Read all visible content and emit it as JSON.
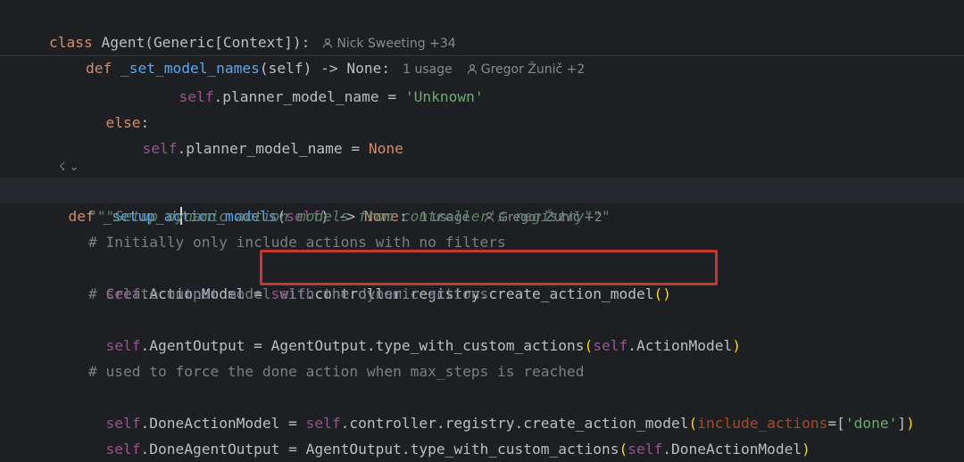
{
  "sticky": {
    "class_def": {
      "keyword": "class",
      "name": " Agent(Generic[Context]):",
      "author": "Nick Sweeting +34"
    },
    "method_def": {
      "keyword": "def",
      "name": "_set_model_names",
      "params": "(self) -> None:",
      "usage": "1 usage",
      "author": "Gregor Žunič +2"
    }
  },
  "code": {
    "line1": {
      "self": "self",
      "rest": ".planner_model_name = ",
      "value": "'Unknown'"
    },
    "line2": {
      "keyword": "else",
      "rest": ":"
    },
    "line3": {
      "self": "self",
      "rest": ".planner_model_name = ",
      "value": "None"
    },
    "gutter_icon": "☇",
    "method": {
      "keyword": "def",
      "name_before_caret": "_setup_ac",
      "name_after_caret": "tion_models",
      "paren_open": "(",
      "self": "self",
      "paren_close": ")",
      "returns": " -> ",
      "none": "None",
      "colon": ":",
      "usage": "1 usage",
      "author": "Gregor Žunič +2"
    },
    "docstring": "\"\"\"Setup dynamic action models from controller's registry\"\"\"",
    "comment1": "# Initially only include actions with no filters",
    "line_action_model": {
      "self": "self",
      "lhs": ".ActionModel = ",
      "self2": "self",
      "rhs": ".controller.registry.create_action_model",
      "parens": "()"
    },
    "comment2": "# Create output model with the dynamic actions",
    "line_agent_output": {
      "self": "self",
      "lhs": ".AgentOutput = AgentOutput.type_with_custom_actions",
      "paren_open": "(",
      "self2": "self",
      "arg": ".ActionModel",
      "paren_close": ")"
    },
    "comment3": "# used to force the done action when max_steps is reached",
    "line_done_action": {
      "self": "self",
      "lhs": ".DoneActionModel = ",
      "self2": "self",
      "rhs": ".controller.registry.create_action_model",
      "paren_open": "(",
      "kwarg": "include_actions",
      "eq": "=",
      "list_open": "[",
      "value": "'done'",
      "list_close": "]",
      "paren_close": ")"
    },
    "line_done_agent": {
      "self": "self",
      "lhs": ".DoneAgentOutput = AgentOutput.type_with_custom_actions",
      "paren_open": "(",
      "self2": "self",
      "arg": ".DoneActionModel",
      "paren_close": ")"
    }
  },
  "colors": {
    "background": "#1e1f22",
    "keyword": "#cf8e6d",
    "self": "#94558d",
    "function": "#56a8f5",
    "string": "#6aab73",
    "docstring": "#5f826b",
    "comment": "#7a7e85",
    "highlight_box": "#c8372d"
  }
}
